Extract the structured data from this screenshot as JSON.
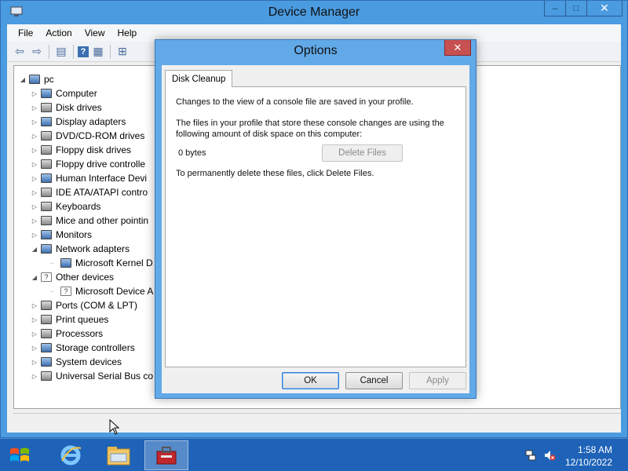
{
  "window": {
    "title": "Device Manager",
    "controls": {
      "minimize": "‒",
      "maximize": "□",
      "close": "✕"
    }
  },
  "menubar": [
    "File",
    "Action",
    "View",
    "Help"
  ],
  "toolbar_icons": [
    "back-arrow-icon",
    "forward-arrow-icon",
    "show-hide-console-tree-icon",
    "help-icon",
    "properties-icon",
    "scan-hardware-icon"
  ],
  "tree": {
    "root": "pc",
    "items": [
      {
        "label": "Computer",
        "state": "collapsed",
        "icon": "computer-icon"
      },
      {
        "label": "Disk drives",
        "state": "collapsed",
        "icon": "disk-drive-icon"
      },
      {
        "label": "Display adapters",
        "state": "collapsed",
        "icon": "display-adapter-icon"
      },
      {
        "label": "DVD/CD-ROM drives",
        "state": "collapsed",
        "icon": "dvd-drive-icon"
      },
      {
        "label": "Floppy disk drives",
        "state": "collapsed",
        "icon": "floppy-disk-icon"
      },
      {
        "label": "Floppy drive controlle",
        "state": "collapsed",
        "icon": "floppy-controller-icon"
      },
      {
        "label": "Human Interface Devi",
        "state": "collapsed",
        "icon": "hid-icon"
      },
      {
        "label": "IDE ATA/ATAPI contro",
        "state": "collapsed",
        "icon": "ide-controller-icon"
      },
      {
        "label": "Keyboards",
        "state": "collapsed",
        "icon": "keyboard-icon"
      },
      {
        "label": "Mice and other pointin",
        "state": "collapsed",
        "icon": "mouse-icon"
      },
      {
        "label": "Monitors",
        "state": "collapsed",
        "icon": "monitor-icon"
      },
      {
        "label": "Network adapters",
        "state": "expanded",
        "icon": "network-adapter-icon"
      },
      {
        "label": "Microsoft Kernel D",
        "state": "child",
        "icon": "network-adapter-icon"
      },
      {
        "label": "Other devices",
        "state": "expanded",
        "icon": "unknown-device-icon"
      },
      {
        "label": "Microsoft Device A",
        "state": "child",
        "icon": "unknown-device-icon"
      },
      {
        "label": "Ports (COM & LPT)",
        "state": "collapsed",
        "icon": "port-icon"
      },
      {
        "label": "Print queues",
        "state": "collapsed",
        "icon": "printer-icon"
      },
      {
        "label": "Processors",
        "state": "collapsed",
        "icon": "processor-icon"
      },
      {
        "label": "Storage controllers",
        "state": "collapsed",
        "icon": "storage-controller-icon"
      },
      {
        "label": "System devices",
        "state": "collapsed",
        "icon": "system-device-icon"
      },
      {
        "label": "Universal Serial Bus co",
        "state": "collapsed",
        "icon": "usb-icon"
      }
    ]
  },
  "dialog": {
    "title": "Options",
    "close": "✕",
    "tab": "Disk Cleanup",
    "text1": "Changes to the view of a console file are saved in your profile.",
    "text2": "The files in your profile that store these console changes are using the following amount of disk space on this computer:",
    "size": "0 bytes",
    "delete_button": "Delete Files",
    "text3": "To permanently delete these files, click Delete Files.",
    "ok": "OK",
    "cancel": "Cancel",
    "apply": "Apply"
  },
  "taskbar": {
    "apps": [
      "internet-explorer-icon",
      "file-explorer-icon",
      "device-manager-icon"
    ],
    "time": "1:58 AM",
    "date": "12/10/2022"
  }
}
